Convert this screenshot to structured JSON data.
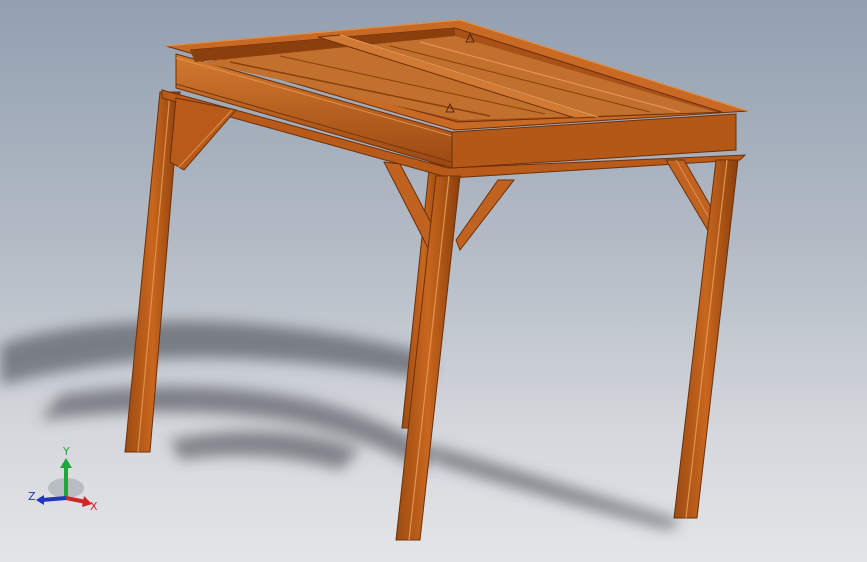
{
  "viewport": {
    "background_top": "#93a0b1",
    "background_bottom": "#e4e5e8"
  },
  "model": {
    "material_color": "#c8661e",
    "material_dark": "#8a3f0c",
    "material_light": "#dc8a3c",
    "shadow_color": "#3a3c44"
  },
  "triad": {
    "x_label": "X",
    "y_label": "Y",
    "z_label": "Z",
    "x_color": "#d22626",
    "y_color": "#1fa83a",
    "z_color": "#2236b8"
  }
}
